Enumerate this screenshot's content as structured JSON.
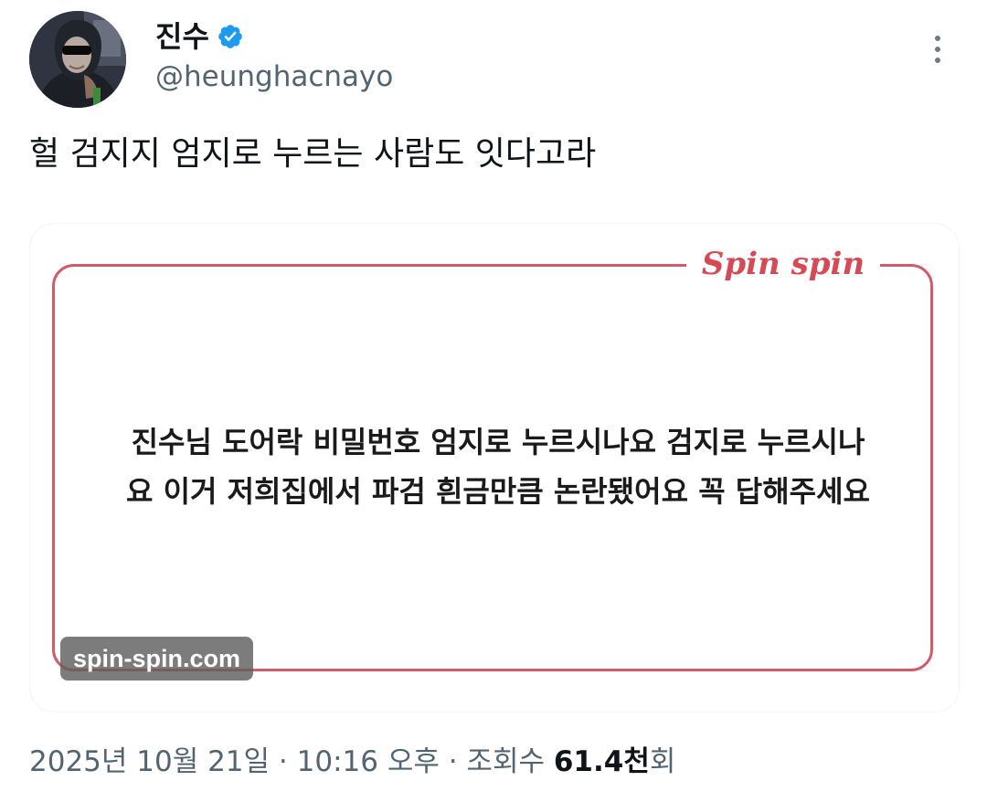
{
  "author": {
    "display_name": "진수",
    "handle": "@heunghacnayo",
    "verified": true,
    "avatar_icon": "person-with-sunglasses-avatar"
  },
  "more_icon": "more-vertical-icon",
  "tweet": {
    "text": "헐 검지지 엄지로 누르는 사람도 잇다고라"
  },
  "media": {
    "brand_logo": "Spin spin",
    "quote_line1": "진수님 도어락 비밀번호 엄지로 누르시나요 검지로 누르시나",
    "quote_line2": "요 이거 저희집에서 파검 흰금만큼 논란됐어요 꼭 답해주세요",
    "watermark": "spin-spin.com",
    "accent_color": "#d35a66"
  },
  "meta": {
    "date": "2025년 10월 21일",
    "sep1": " · ",
    "time": "10:16 오후",
    "sep2": " · ",
    "views_label": "조회수 ",
    "views_count": "61.4천",
    "views_suffix": "회"
  },
  "colors": {
    "text_primary": "#0f1419",
    "text_secondary": "#536471",
    "verified_blue": "#1d9bf0"
  }
}
